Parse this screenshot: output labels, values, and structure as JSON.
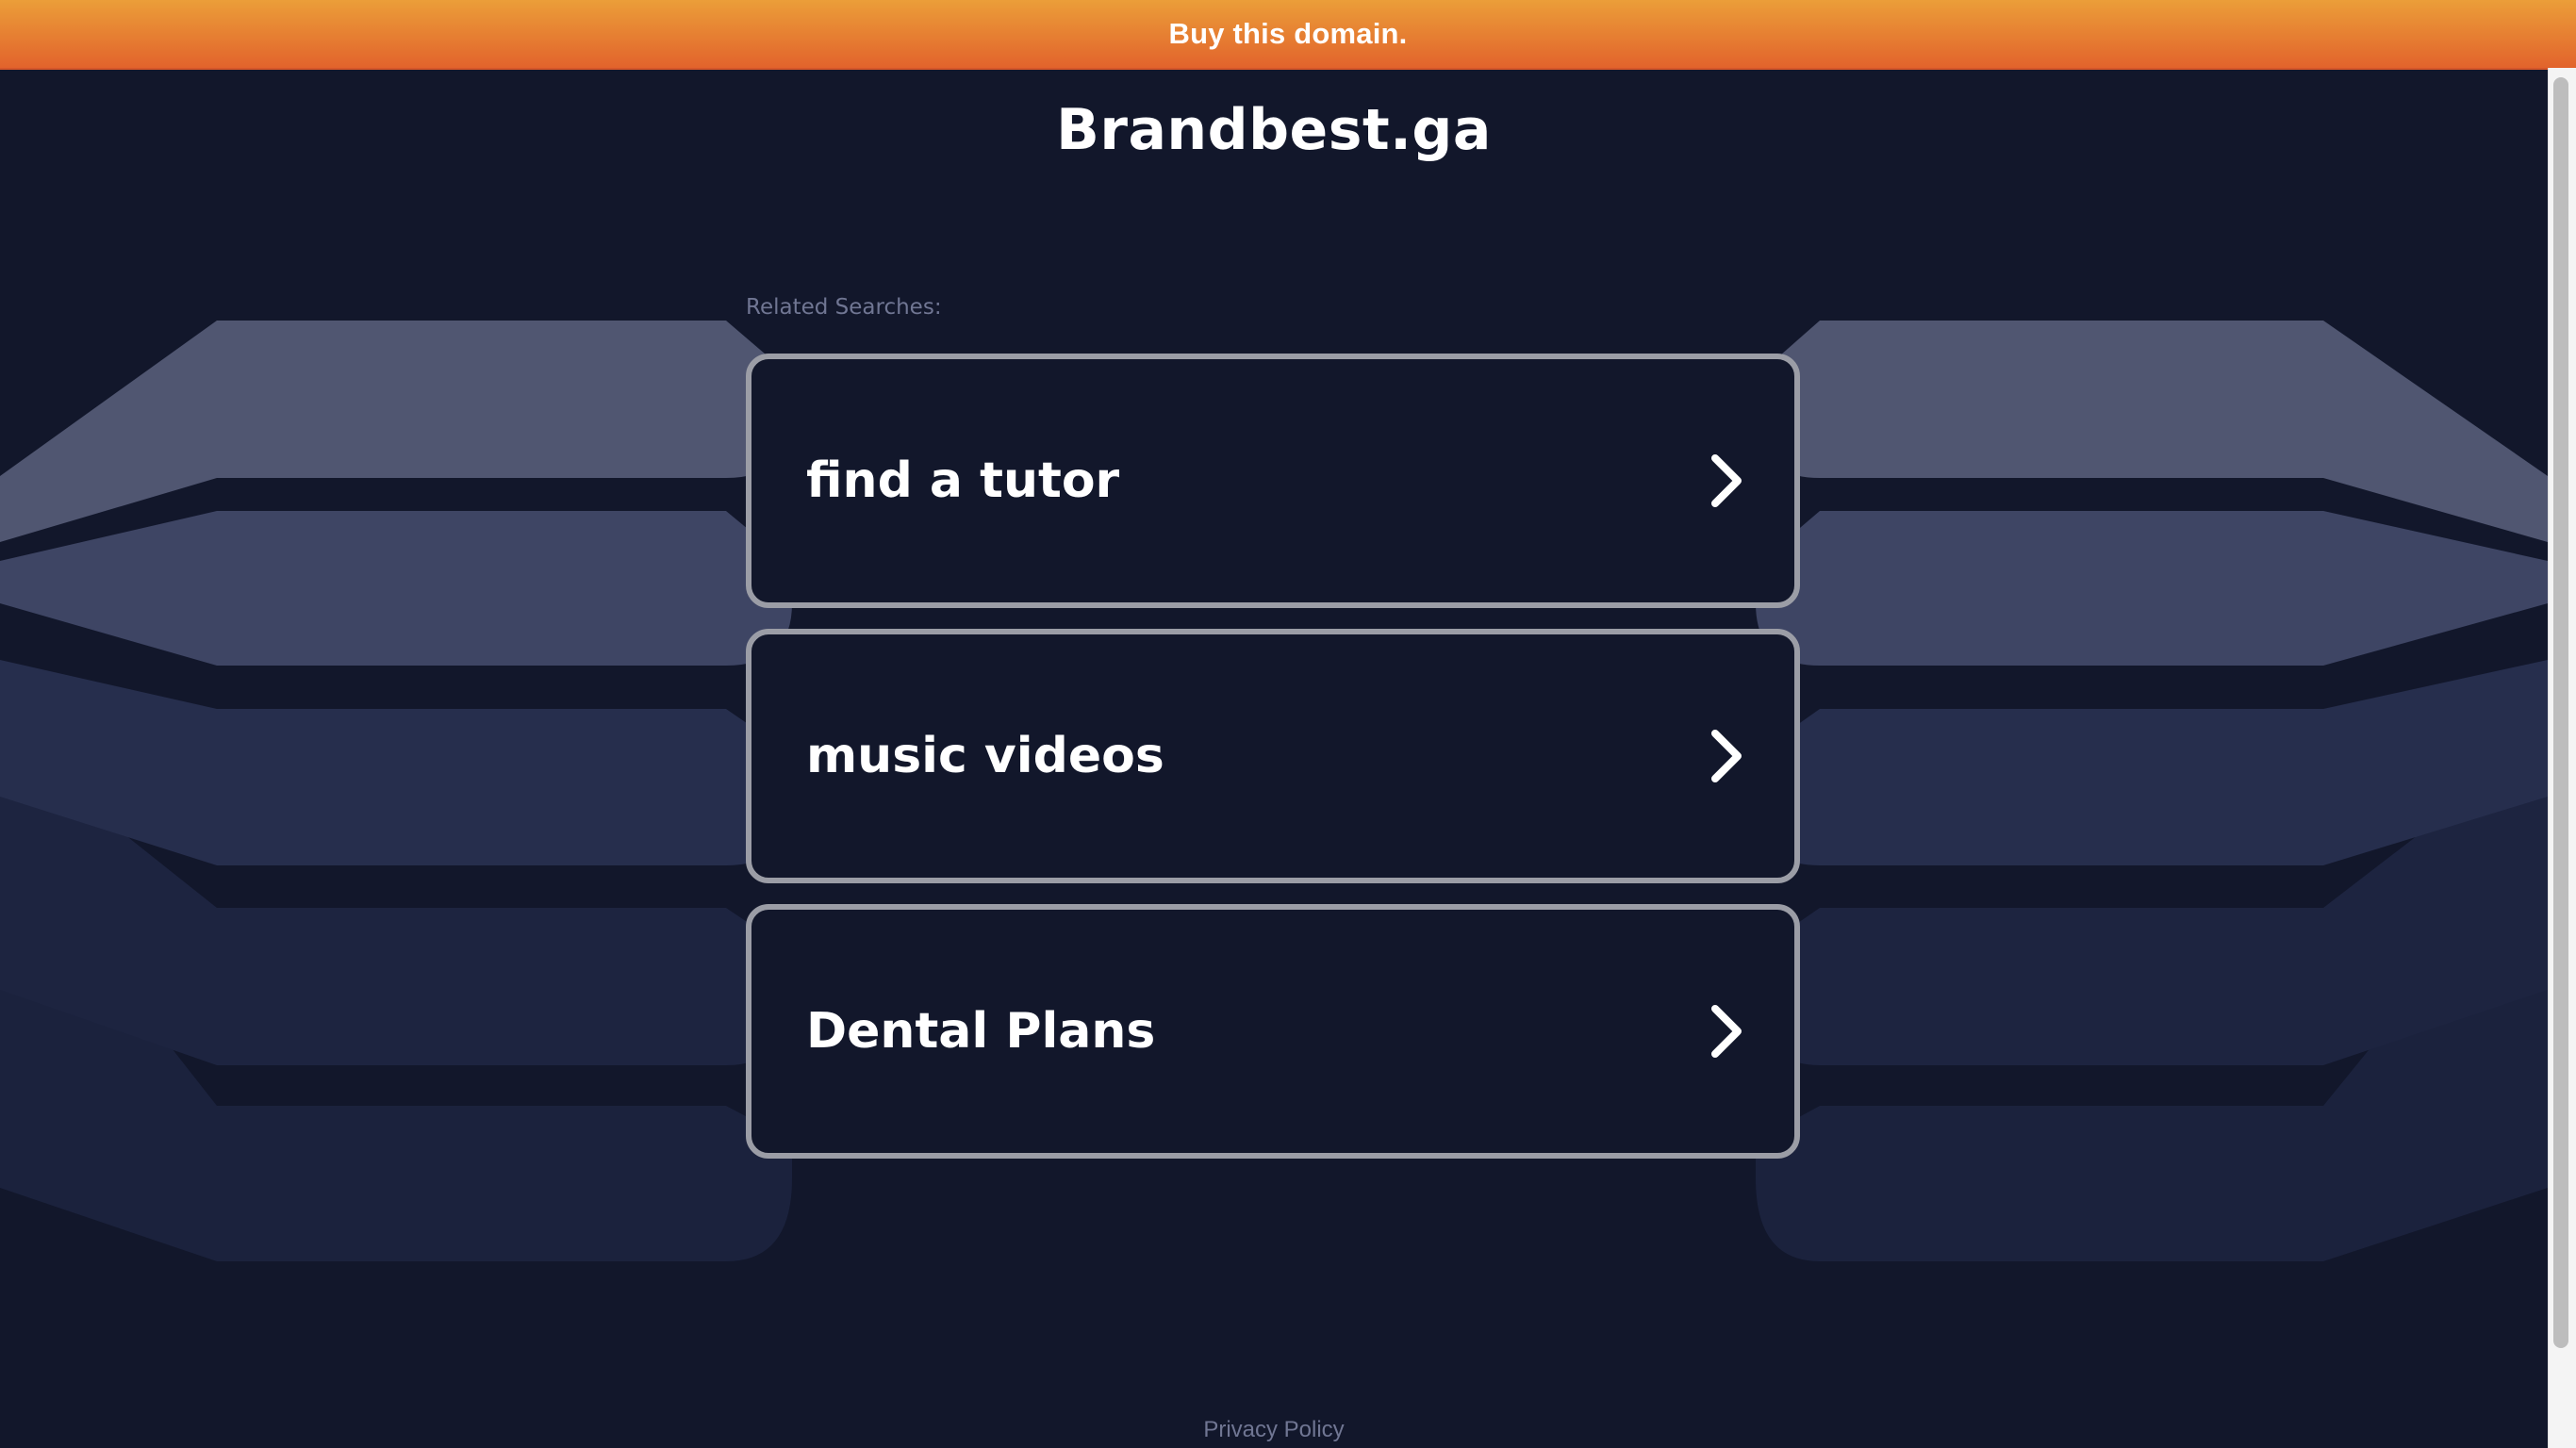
{
  "banner": {
    "label": "Buy this domain."
  },
  "site": {
    "title": "Brandbest.ga"
  },
  "related": {
    "heading": "Related Searches:",
    "items": [
      {
        "label": "find a tutor",
        "icon": "chevron-right-icon"
      },
      {
        "label": "music videos",
        "icon": "chevron-right-icon"
      },
      {
        "label": "Dental Plans",
        "icon": "chevron-right-icon"
      }
    ]
  },
  "footer": {
    "privacy_label": "Privacy Policy"
  },
  "colors": {
    "background": "#12172b",
    "banner_top": "#eb9e39",
    "banner_bottom": "#e2632c",
    "card_border": "#9b9da6",
    "muted_text": "#707693"
  }
}
